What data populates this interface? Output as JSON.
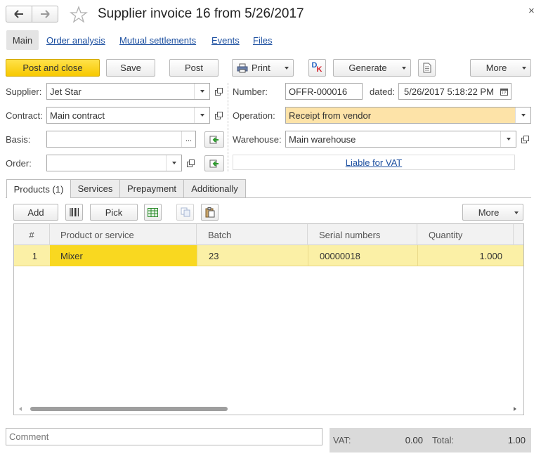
{
  "window": {
    "title": "Supplier invoice 16 from 5/26/2017",
    "close": "×"
  },
  "nav_tabs": [
    "Main",
    "Order analysis",
    "Mutual settlements",
    "Events",
    "Files"
  ],
  "toolbar": {
    "post_close": "Post and close",
    "save": "Save",
    "post": "Post",
    "print": "Print",
    "dk_d": "D",
    "dk_k": "K",
    "generate": "Generate",
    "more": "More"
  },
  "form": {
    "supplier_label": "Supplier:",
    "supplier_value": "Jet Star",
    "contract_label": "Contract:",
    "contract_value": "Main contract",
    "basis_label": "Basis:",
    "basis_value": "",
    "order_label": "Order:",
    "order_value": "",
    "number_label": "Number:",
    "number_value": "OFFR-000016",
    "dated_label": "dated:",
    "dated_value": "5/26/2017  5:18:22 PM",
    "operation_label": "Operation:",
    "operation_value": "Receipt from vendor",
    "warehouse_label": "Warehouse:",
    "warehouse_value": "Main warehouse",
    "vat_link": "Liable for VAT",
    "dots": "..."
  },
  "inner_tabs": [
    "Products (1)",
    "Services",
    "Prepayment",
    "Additionally"
  ],
  "table_toolbar": {
    "add": "Add",
    "pick": "Pick",
    "more": "More"
  },
  "table": {
    "columns": [
      "#",
      "Product or service",
      "Batch",
      "Serial numbers",
      "Quantity"
    ],
    "rows": [
      {
        "num": "1",
        "product": "Mixer",
        "batch": "23",
        "serial": "00000018",
        "quantity": "1.000"
      }
    ]
  },
  "footer": {
    "comment_placeholder": "Comment",
    "vat_label": "VAT:",
    "vat_value": "0.00",
    "total_label": "Total:",
    "total_value": "1.00"
  },
  "colors": {
    "accent_yellow": "#f7c800",
    "row_highlight": "#fbf0a6",
    "selected_cell": "#f9d820",
    "operation_bg": "#fde3a8",
    "link": "#1c4fa0"
  }
}
